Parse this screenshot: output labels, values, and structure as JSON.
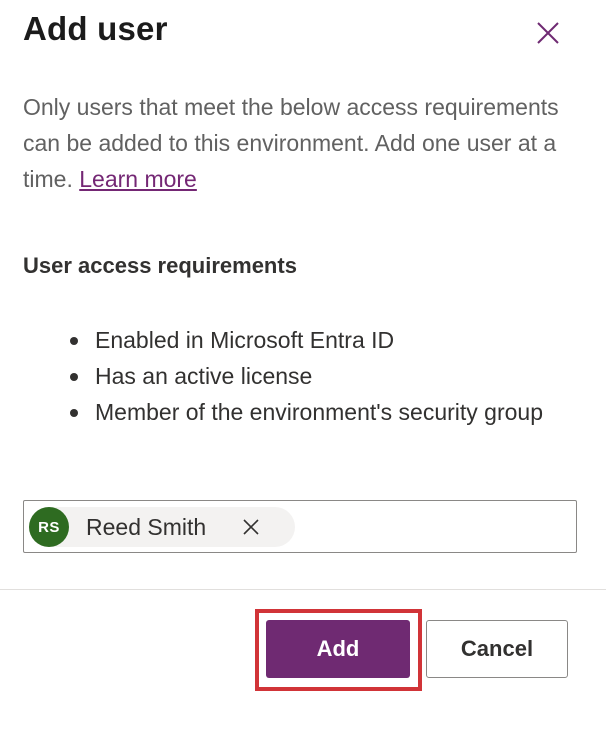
{
  "dialog": {
    "title": "Add user",
    "close_icon": "close-icon",
    "description_text": "Only users that meet the below access requirements can be added to this environment. Add one user at a time.",
    "learn_more_link": "Learn more",
    "requirements_heading": "User access requirements",
    "requirements": [
      "Enabled in Microsoft Entra ID",
      "Has an active license",
      "Member of the environment's security group"
    ]
  },
  "people_picker": {
    "selected_user": {
      "initials": "RS",
      "name": "Reed Smith",
      "avatar_color": "#2e6b21",
      "remove_icon": "close-icon"
    }
  },
  "footer": {
    "add_label": "Add",
    "cancel_label": "Cancel",
    "primary_color": "#6f2a72",
    "highlight_color": "#d13438"
  }
}
